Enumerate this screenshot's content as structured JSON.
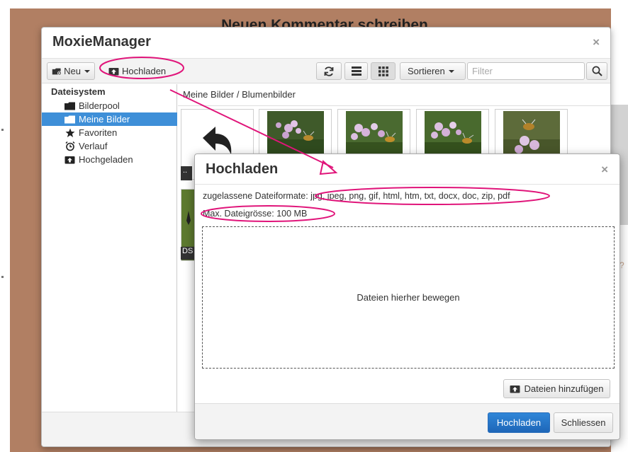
{
  "background": {
    "heading": "Neuen Kommentar schreiben",
    "color": "#b17f63",
    "side_glyph": "?"
  },
  "window": {
    "title": "MoxieManager",
    "close_glyph": "×"
  },
  "toolbar": {
    "new_label": "Neu",
    "upload_label": "Hochladen",
    "sort_label": "Sortieren",
    "filter_placeholder": "Filter",
    "icons": [
      "new-folder-icon",
      "upload-icon",
      "refresh-icon",
      "list-view-icon",
      "grid-view-icon",
      "search-icon"
    ]
  },
  "sidebar": {
    "heading": "Dateisystem",
    "items": [
      {
        "label": "Bilderpool",
        "icon": "folder-icon"
      },
      {
        "label": "Meine Bilder",
        "icon": "folder-open-icon",
        "active": true
      },
      {
        "label": "Favoriten",
        "icon": "star-icon"
      },
      {
        "label": "Verlauf",
        "icon": "clock-icon"
      },
      {
        "label": "Hochgeladen",
        "icon": "upload-icon"
      }
    ]
  },
  "content": {
    "path": "Meine Bilder / Blumenbilder",
    "back_label": "..",
    "file_label_fragment": "DS"
  },
  "dialog": {
    "title": "Hochladen",
    "close_glyph": "×",
    "formats_text": "zugelassene Dateiformate: jpg, jpeg, png, gif, html, htm, txt, docx, doc, zip, pdf",
    "max_size_text": "Max. Dateigrösse: 100 MB",
    "dropzone_text": "Dateien hierher bewegen",
    "add_files_label": "Dateien hinzufügen",
    "upload_button": "Hochladen",
    "close_button": "Schliessen"
  },
  "colors": {
    "accent": "#3e8fd8",
    "primary_button": "#1e66b8",
    "annotation": "#e0157a"
  }
}
